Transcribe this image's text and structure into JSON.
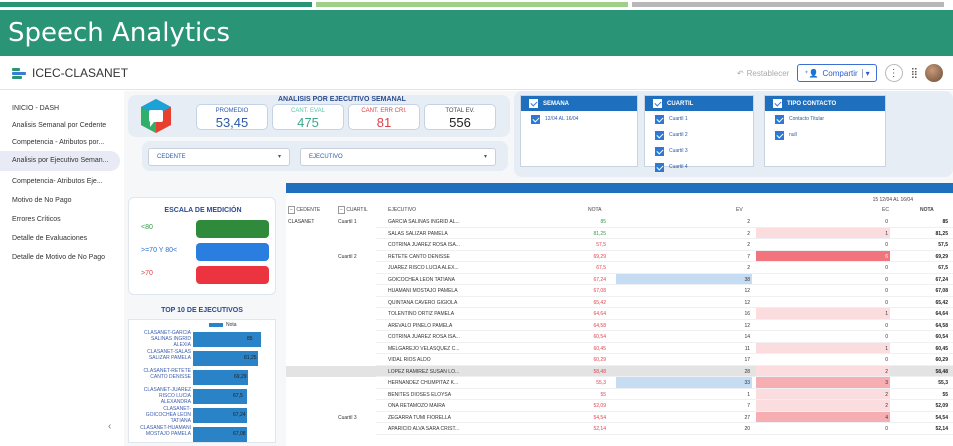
{
  "page_banner": {
    "title": "Speech Analytics"
  },
  "topbar": {
    "app_name": "ICEC-CLASANET",
    "reset_label": "Restablecer",
    "share_label": "Compartir"
  },
  "sidebar": {
    "items": [
      {
        "label": "INICIO - DASH",
        "active": false
      },
      {
        "label": "Analisis Semanal por Cedente",
        "active": false
      },
      {
        "label": "Competencia - Atributos por...",
        "active": false
      },
      {
        "label": "Analisis por Ejecutivo Seman...",
        "active": true
      },
      {
        "label": "Competencia- Atributos Eje...",
        "active": false
      },
      {
        "label": "Motivo de No Pago",
        "active": false
      },
      {
        "label": "Errores Críticos",
        "active": false
      },
      {
        "label": "Detalle de Evaluaciones",
        "active": false
      },
      {
        "label": "Detalle de Motivo de No Pago",
        "active": false
      }
    ],
    "collapse_icon": "chevron-left-icon"
  },
  "kpis": {
    "title": "ANALISIS POR EJECUTIVO SEMANAL",
    "cards": [
      {
        "label": "PROMEDIO",
        "value": "53,45",
        "label_color": "#2b5aa8",
        "value_color": "#2b5aa8"
      },
      {
        "label": "CANT. EVAL",
        "value": "475",
        "label_color": "#5cc6a8",
        "value_color": "#3aa888"
      },
      {
        "label": "CANT. ERR CRI.",
        "value": "81",
        "label_color": "#e0404a",
        "value_color": "#e0404a"
      },
      {
        "label": "TOTAL EV.",
        "value": "556",
        "label_color": "#444444",
        "value_color": "#222222"
      }
    ]
  },
  "dropdowns": {
    "cedente": "CEDENTE",
    "ejecutivo": "EJECUTIVO"
  },
  "filters": {
    "semana": {
      "title": "SEMANA",
      "options": [
        "12/04 AL 16/04"
      ]
    },
    "cuartil": {
      "title": "CUARTIL",
      "options": [
        "Cuartil 1",
        "Cuartil 2",
        "Cuartil 3",
        "Cuartil 4"
      ]
    },
    "tipo_contacto": {
      "title": "TIPO CONTACTO",
      "options": [
        "Contacto Titular",
        "null"
      ]
    }
  },
  "scale": {
    "title": "ESCALA DE MEDICIÓN",
    "rows": [
      {
        "label": "<80",
        "label_color": "#2f9a4a",
        "color": "#2f8a3c"
      },
      {
        "label": ">=70 Y 80<",
        "label_color": "#2a6fd0",
        "color": "#2a7ee0"
      },
      {
        "label": ">70",
        "label_color": "#e0404a",
        "color": "#ec3340"
      }
    ]
  },
  "top_ten": {
    "title": "TOP 10 DE EJECUTIVOS",
    "legend": "Nota",
    "chart_data": {
      "type": "bar",
      "orientation": "horizontal",
      "categories": [
        "CLASANET-GARCIA SALINAS INGRID ALEXIA",
        "CLASANET-SALAS SALIZAR PAMELA",
        "CLASANET-RETETE CANTO DENISSE",
        "CLASANET-JUAREZ RISCO LUCIA ALEXANDRA",
        "CLASANET-GOICOCHEA LEON TATIANA",
        "CLASANET-HUAMANI MOSTAJO PAMELA"
      ],
      "values_text": [
        "85",
        "81,25",
        "69,29",
        "67,5",
        "67,24",
        "67,08"
      ],
      "values": [
        85,
        81.25,
        69.29,
        67.5,
        67.24,
        67.08
      ],
      "series": [
        {
          "name": "Nota"
        }
      ]
    }
  },
  "table": {
    "week_header": "15 12/04 AL 16/04",
    "headers": {
      "cedente": "CEDENTE",
      "cuartil": "CUARTIL",
      "ejecutivo": "EJECUTIVO",
      "nota": "NOTA",
      "ev": "EV",
      "ec": "EC",
      "nota_total": "NOTA"
    },
    "rows": [
      {
        "cedente": "CLASANET",
        "cuartil": "Cuartil 1",
        "ejecutivo": "GARCIA SALINAS INGRID AL...",
        "nota": "85",
        "nota_color": "#2f9a4a",
        "ev": "2",
        "ev_fill": 0.0,
        "ec": "0",
        "ec_fill": 0.0,
        "total": "85"
      },
      {
        "cedente": "",
        "cuartil": "",
        "ejecutivo": "SALAS SALIZAR PAMELA",
        "nota": "81,25",
        "nota_color": "#2f9a4a",
        "ev": "2",
        "ev_fill": 0.0,
        "ec": "1",
        "ec_fill": 0.2,
        "total": "81,25"
      },
      {
        "cedente": "",
        "cuartil": "",
        "ejecutivo": "COTRINA JUAREZ ROSA ISA...",
        "nota": "57,5",
        "nota_color": "#e0404a",
        "ev": "2",
        "ev_fill": 0.0,
        "ec": "0",
        "ec_fill": 0.0,
        "total": "57,5"
      },
      {
        "cedente": "",
        "cuartil": "Cuartil 2",
        "ejecutivo": "RETETE CANTO DENISSE",
        "nota": "69,29",
        "nota_color": "#e0404a",
        "ev": "7",
        "ev_fill": 0.0,
        "ec": "6",
        "ec_fill": 1.0,
        "total": "69,29"
      },
      {
        "cedente": "",
        "cuartil": "",
        "ejecutivo": "JUAREZ RISCO LUCIA ALEX...",
        "nota": "67,5",
        "nota_color": "#e0404a",
        "ev": "2",
        "ev_fill": 0.0,
        "ec": "0",
        "ec_fill": 0.0,
        "total": "67,5"
      },
      {
        "cedente": "",
        "cuartil": "",
        "ejecutivo": "GOICOCHEA LEON TATIANA",
        "nota": "67,24",
        "nota_color": "#e0404a",
        "ev": "38",
        "ev_fill": 0.8,
        "ec": "0",
        "ec_fill": 0.0,
        "total": "67,24"
      },
      {
        "cedente": "",
        "cuartil": "",
        "ejecutivo": "HUAMANI MOSTAJO PAMELA",
        "nota": "67,08",
        "nota_color": "#e0404a",
        "ev": "12",
        "ev_fill": 0.0,
        "ec": "0",
        "ec_fill": 0.0,
        "total": "67,08"
      },
      {
        "cedente": "",
        "cuartil": "",
        "ejecutivo": "QUINTANA CAVERO GIGIOLA",
        "nota": "65,42",
        "nota_color": "#e0404a",
        "ev": "12",
        "ev_fill": 0.0,
        "ec": "0",
        "ec_fill": 0.0,
        "total": "65,42"
      },
      {
        "cedente": "",
        "cuartil": "",
        "ejecutivo": "TOLENTINO ORTIZ PAMELA",
        "nota": "64,64",
        "nota_color": "#e0404a",
        "ev": "16",
        "ev_fill": 0.0,
        "ec": "1",
        "ec_fill": 0.2,
        "total": "64,64"
      },
      {
        "cedente": "",
        "cuartil": "",
        "ejecutivo": "AREVALO PINELO PAMELA",
        "nota": "64,58",
        "nota_color": "#e0404a",
        "ev": "12",
        "ev_fill": 0.0,
        "ec": "0",
        "ec_fill": 0.0,
        "total": "64,58"
      },
      {
        "cedente": "",
        "cuartil": "",
        "ejecutivo": "COTRINA JUAREZ ROSA ISA...",
        "nota": "60,54",
        "nota_color": "#e0404a",
        "ev": "14",
        "ev_fill": 0.0,
        "ec": "0",
        "ec_fill": 0.0,
        "total": "60,54"
      },
      {
        "cedente": "",
        "cuartil": "",
        "ejecutivo": "MELGAREJO VELASQUEZ C...",
        "nota": "60,45",
        "nota_color": "#e0404a",
        "ev": "11",
        "ev_fill": 0.0,
        "ec": "1",
        "ec_fill": 0.2,
        "total": "60,45"
      },
      {
        "cedente": "",
        "cuartil": "",
        "ejecutivo": "VIDAL RIOS ALDO",
        "nota": "60,29",
        "nota_color": "#e0404a",
        "ev": "17",
        "ev_fill": 0.0,
        "ec": "0",
        "ec_fill": 0.0,
        "total": "60,29"
      },
      {
        "cedente": "",
        "cuartil": "",
        "ejecutivo": "LOPEZ RAMIREZ SUSAN LO...",
        "nota": "58,48",
        "nota_color": "#e0404a",
        "ev": "28",
        "ev_fill": 0.0,
        "ec": "2",
        "ec_fill": 0.2,
        "total": "58,48"
      },
      {
        "cedente": "",
        "cuartil": "",
        "ejecutivo": "HERNANDEZ CHUMPITAZ K...",
        "nota": "55,3",
        "nota_color": "#e0404a",
        "ev": "33",
        "ev_fill": 0.8,
        "ec": "3",
        "ec_fill": 0.5,
        "total": "55,3"
      },
      {
        "cedente": "",
        "cuartil": "",
        "ejecutivo": "BENITES DIOSES ELOYSA",
        "nota": "55",
        "nota_color": "#e0404a",
        "ev": "1",
        "ev_fill": 0.0,
        "ec": "2",
        "ec_fill": 0.2,
        "total": "55"
      },
      {
        "cedente": "",
        "cuartil": "",
        "ejecutivo": "ONA RETAMOZO MAIRA",
        "nota": "52,09",
        "nota_color": "#e0404a",
        "ev": "7",
        "ev_fill": 0.0,
        "ec": "2",
        "ec_fill": 0.2,
        "total": "52,09"
      },
      {
        "cedente": "",
        "cuartil": "Cuartil 3",
        "ejecutivo": "ZEGARRA TUMI FIORELLA",
        "nota": "54,54",
        "nota_color": "#e0404a",
        "ev": "27",
        "ev_fill": 0.0,
        "ec": "4",
        "ec_fill": 0.5,
        "total": "54,54"
      },
      {
        "cedente": "",
        "cuartil": "",
        "ejecutivo": "APARICIO ALVA SARA CRIST...",
        "nota": "52,14",
        "nota_color": "#e0404a",
        "ev": "20",
        "ev_fill": 0.0,
        "ec": "0",
        "ec_fill": 0.0,
        "total": "52,14"
      }
    ]
  }
}
